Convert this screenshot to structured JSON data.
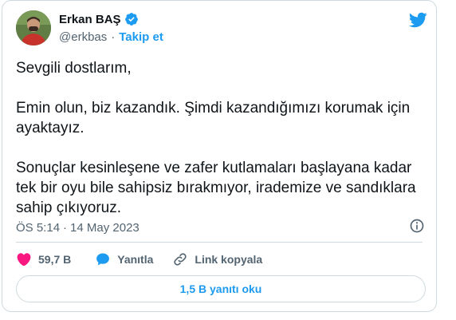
{
  "author": {
    "name": "Erkan BAŞ",
    "handle": "@erkbas",
    "follow_label": "Takip et"
  },
  "tweet": {
    "paragraphs": [
      "Sevgili dostlarım,",
      "Emin olun, biz kazandık. Şimdi kazandığımızı korumak için ayaktayız.",
      "Sonuçlar kesinleşene ve zafer kutlamaları başlayana kadar tek bir oyu bile sahipsiz bırakmıyor, irademize ve sandıklara sahip çıkıyoruz."
    ],
    "time": "ÖS 5:14",
    "date": "14 May 2023"
  },
  "actions": {
    "likes": "59,7 B",
    "reply_label": "Yanıtla",
    "copy_link_label": "Link kopyala"
  },
  "replies_button": "1,5 B yanıtı oku",
  "colors": {
    "accent": "#1d9bf0",
    "like": "#f91880",
    "text": "#0f1419",
    "muted": "#536471",
    "border": "#cfd9de"
  },
  "icons": [
    "verified-badge-icon",
    "twitter-bird-icon",
    "info-icon",
    "heart-icon",
    "reply-bubble-icon",
    "link-icon"
  ]
}
